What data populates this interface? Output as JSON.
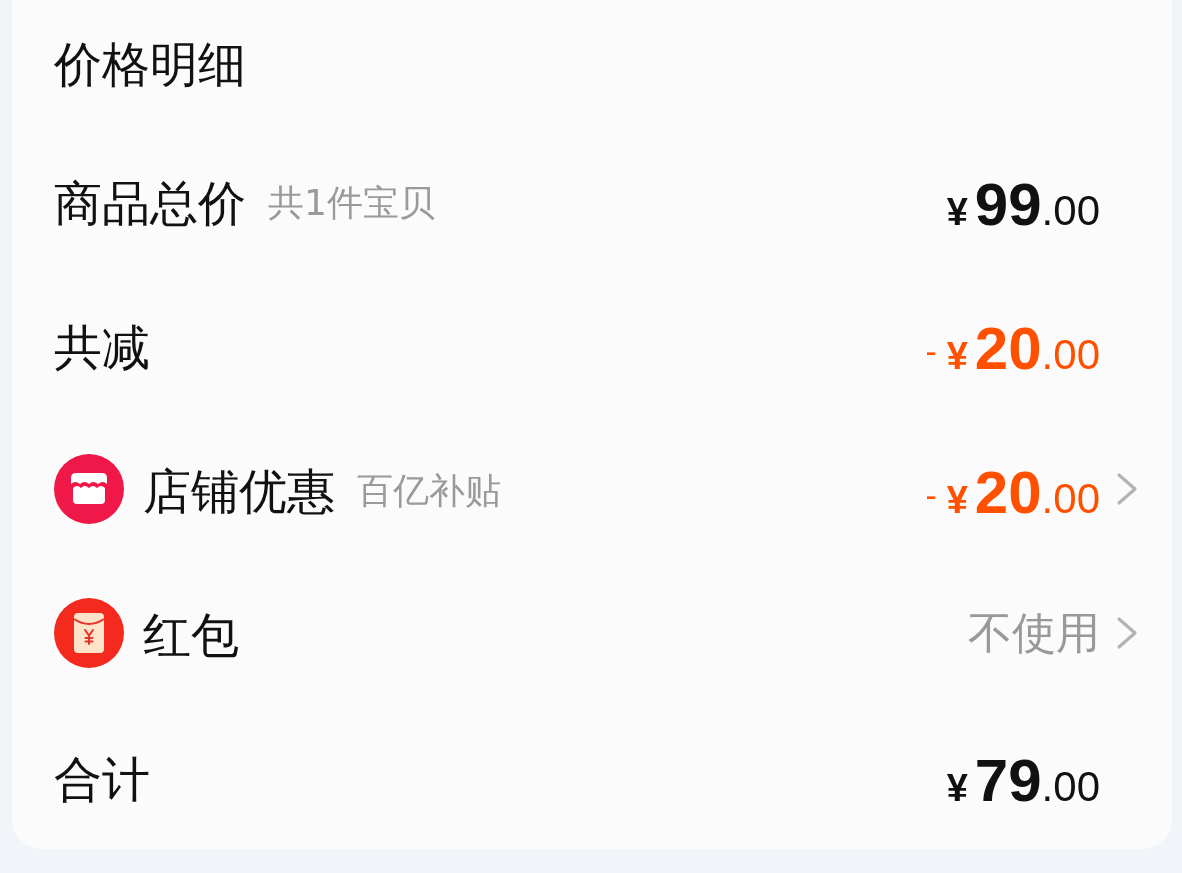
{
  "title": "价格明细",
  "rows": [
    {
      "kind": "plain",
      "label": "商品总价",
      "note": "共1件宝贝",
      "amount": {
        "currency": "¥",
        "integer": "99",
        "decimals": ".00"
      },
      "highlight": false,
      "chevron": false
    },
    {
      "kind": "plain",
      "label": "共减",
      "amount": {
        "sign": "-",
        "currency": "¥",
        "integer": "20",
        "decimals": ".00"
      },
      "highlight": true,
      "chevron": false
    },
    {
      "kind": "shop",
      "label": "店铺优惠",
      "note": "百亿补贴",
      "amount": {
        "sign": "-",
        "currency": "¥",
        "integer": "20",
        "decimals": ".00"
      },
      "highlight": true,
      "chevron": true
    },
    {
      "kind": "envelope",
      "label": "红包",
      "value": "不使用",
      "chevron": true
    },
    {
      "kind": "plain",
      "label": "合计",
      "amount": {
        "currency": "¥",
        "integer": "79",
        "decimals": ".00"
      },
      "highlight": false,
      "chevron": false
    }
  ]
}
